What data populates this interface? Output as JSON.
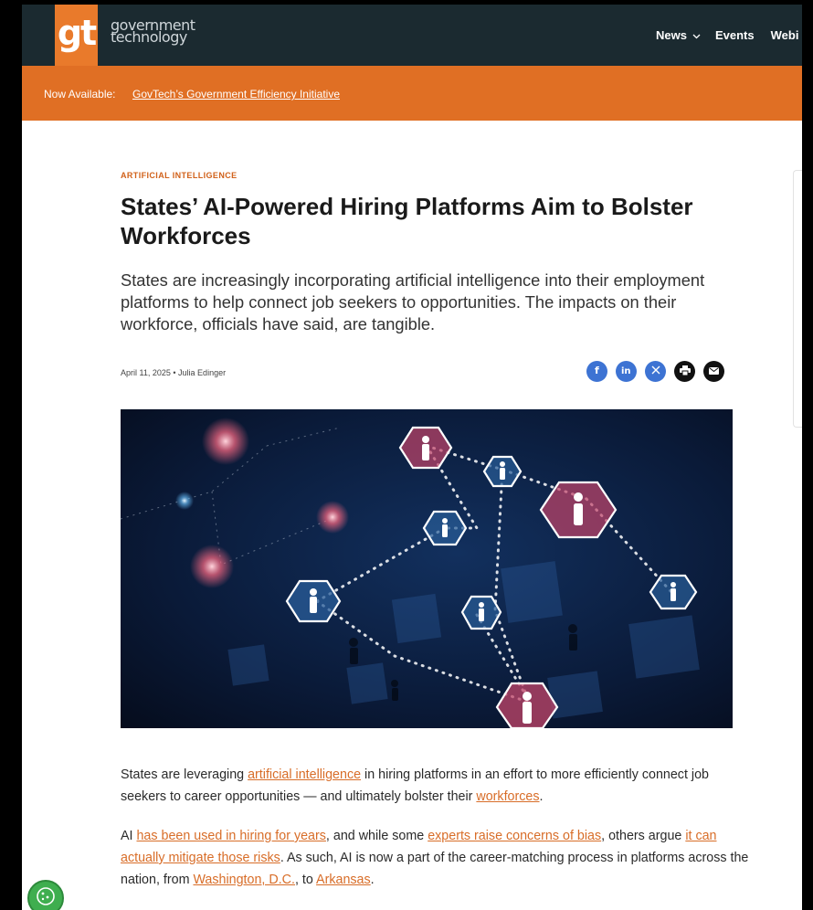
{
  "header": {
    "logo_mark": "gt",
    "logo_line1": "government",
    "logo_line2": "technology",
    "nav": [
      {
        "label": "News"
      },
      {
        "label": "Events"
      },
      {
        "label": "Webi"
      }
    ]
  },
  "promo": {
    "label": "Now Available:",
    "link": "GovTech’s Government Efficiency Initiative"
  },
  "article": {
    "category": "ARTIFICIAL INTELLIGENCE",
    "title": "States’ AI-Powered Hiring Platforms Aim to Bolster Workforces",
    "subtitle": "States are increasingly incorporating artificial intelligence into their employment platforms to help connect job seekers to opportunities. The impacts on their workforce, officials have said, are tangible.",
    "date": "April 11, 2025",
    "author": "Julia Edinger",
    "share_icons": [
      "facebook-icon",
      "linkedin-icon",
      "x-icon",
      "print-icon",
      "email-icon"
    ],
    "p1": {
      "t1": "States are leveraging ",
      "l1": "artificial intelligence",
      "t2": " in hiring platforms in an effort to more efficiently connect job seekers to career opportunities — and ultimately bolster their ",
      "l2": "workforces",
      "t3": "."
    },
    "p2": {
      "t1": "AI ",
      "l1": "has been used in hiring for years",
      "t2": ", and while some ",
      "l2": "experts raise concerns of bias",
      "t3": ", others argue ",
      "l3": "it can actually mitigate those risks",
      "t4": ". As such, AI is now a part of the career-matching process in platforms across the nation, from ",
      "l4": "Washington, D.C.",
      "t5": ", to ",
      "l5": "Arkansas",
      "t6": "."
    }
  },
  "colors": {
    "brand_orange": "#e97a2b",
    "header_dark": "#1b2a30",
    "link": "#d86d28",
    "share_blue": "#3d73d3"
  }
}
